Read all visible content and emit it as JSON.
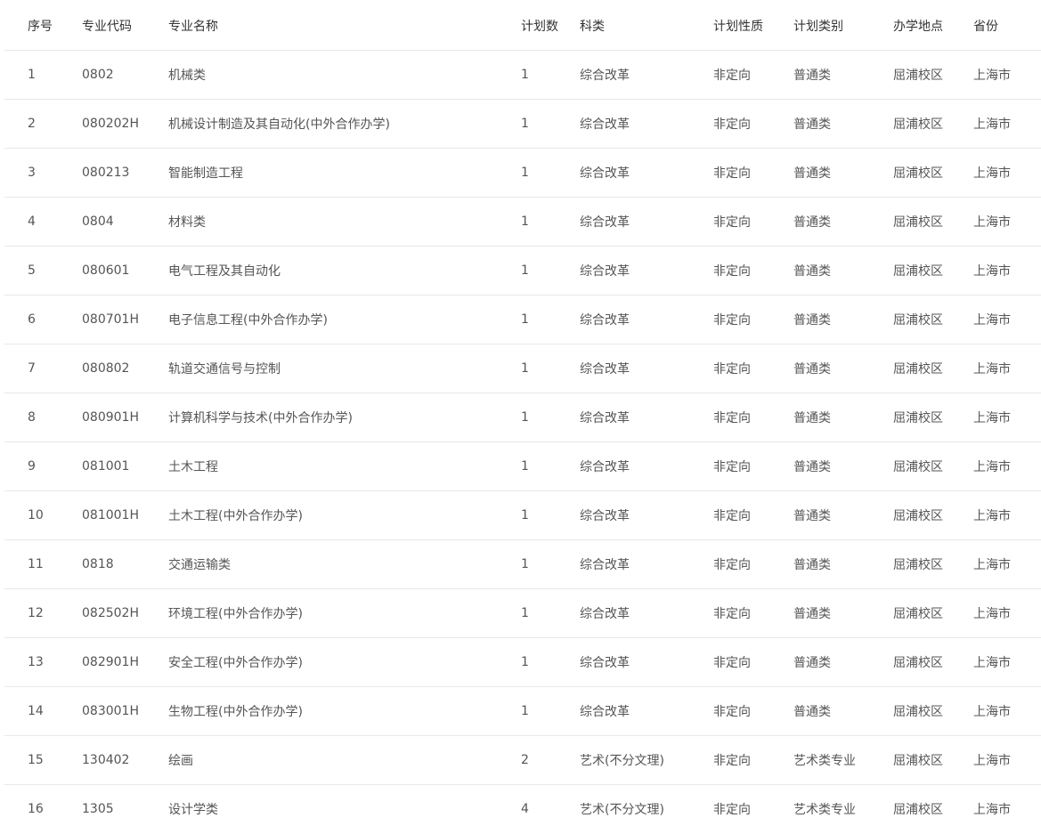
{
  "table": {
    "headers": [
      "序号",
      "专业代码",
      "专业名称",
      "计划数",
      "科类",
      "计划性质",
      "计划类别",
      "办学地点",
      "省份"
    ],
    "rows": [
      [
        "1",
        "0802",
        "机械类",
        "1",
        "综合改革",
        "非定向",
        "普通类",
        "屈浦校区",
        "上海市"
      ],
      [
        "2",
        "080202H",
        "机械设计制造及其自动化(中外合作办学)",
        "1",
        "综合改革",
        "非定向",
        "普通类",
        "屈浦校区",
        "上海市"
      ],
      [
        "3",
        "080213",
        "智能制造工程",
        "1",
        "综合改革",
        "非定向",
        "普通类",
        "屈浦校区",
        "上海市"
      ],
      [
        "4",
        "0804",
        "材料类",
        "1",
        "综合改革",
        "非定向",
        "普通类",
        "屈浦校区",
        "上海市"
      ],
      [
        "5",
        "080601",
        "电气工程及其自动化",
        "1",
        "综合改革",
        "非定向",
        "普通类",
        "屈浦校区",
        "上海市"
      ],
      [
        "6",
        "080701H",
        "电子信息工程(中外合作办学)",
        "1",
        "综合改革",
        "非定向",
        "普通类",
        "屈浦校区",
        "上海市"
      ],
      [
        "7",
        "080802",
        "轨道交通信号与控制",
        "1",
        "综合改革",
        "非定向",
        "普通类",
        "屈浦校区",
        "上海市"
      ],
      [
        "8",
        "080901H",
        "计算机科学与技术(中外合作办学)",
        "1",
        "综合改革",
        "非定向",
        "普通类",
        "屈浦校区",
        "上海市"
      ],
      [
        "9",
        "081001",
        "土木工程",
        "1",
        "综合改革",
        "非定向",
        "普通类",
        "屈浦校区",
        "上海市"
      ],
      [
        "10",
        "081001H",
        "土木工程(中外合作办学)",
        "1",
        "综合改革",
        "非定向",
        "普通类",
        "屈浦校区",
        "上海市"
      ],
      [
        "11",
        "0818",
        "交通运输类",
        "1",
        "综合改革",
        "非定向",
        "普通类",
        "屈浦校区",
        "上海市"
      ],
      [
        "12",
        "082502H",
        "环境工程(中外合作办学)",
        "1",
        "综合改革",
        "非定向",
        "普通类",
        "屈浦校区",
        "上海市"
      ],
      [
        "13",
        "082901H",
        "安全工程(中外合作办学)",
        "1",
        "综合改革",
        "非定向",
        "普通类",
        "屈浦校区",
        "上海市"
      ],
      [
        "14",
        "083001H",
        "生物工程(中外合作办学)",
        "1",
        "综合改革",
        "非定向",
        "普通类",
        "屈浦校区",
        "上海市"
      ],
      [
        "15",
        "130402",
        "绘画",
        "2",
        "艺术(不分文理)",
        "非定向",
        "艺术类专业",
        "屈浦校区",
        "上海市"
      ],
      [
        "16",
        "1305",
        "设计学类",
        "4",
        "艺术(不分文理)",
        "非定向",
        "艺术类专业",
        "屈浦校区",
        "上海市"
      ]
    ]
  }
}
